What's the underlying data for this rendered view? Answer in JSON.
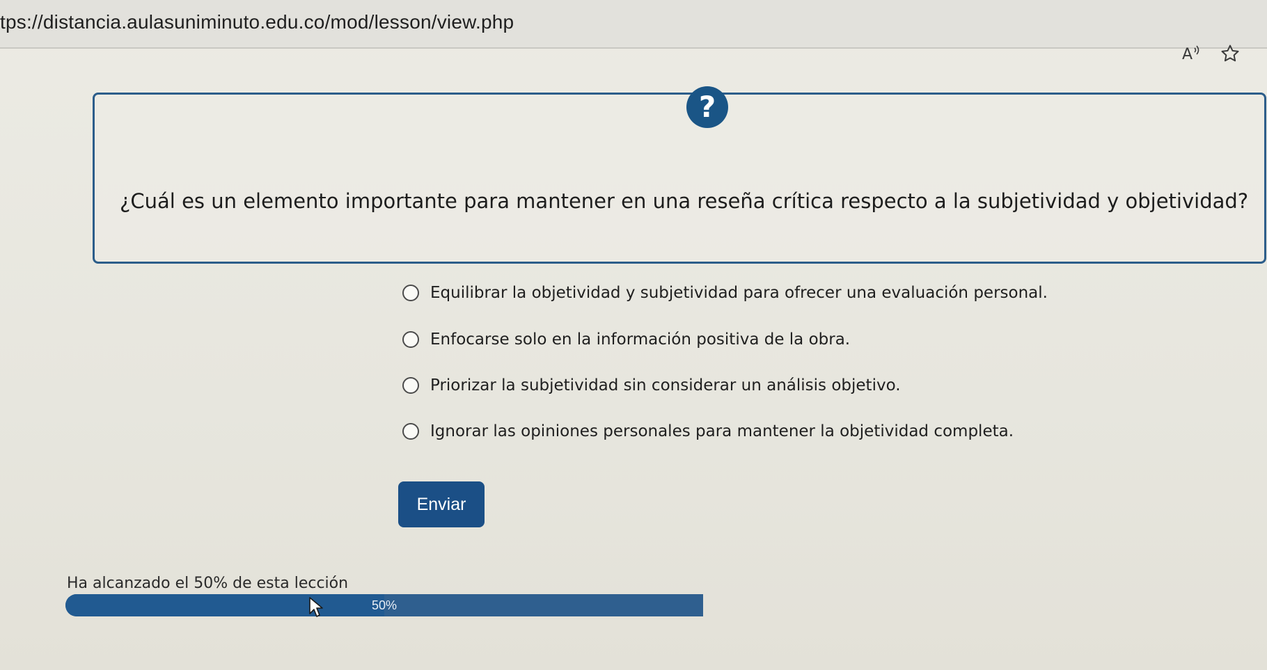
{
  "browser": {
    "url": "tps://distancia.aulasuniminuto.edu.co/mod/lesson/view.php",
    "read_aloud_icon": "read-aloud-icon",
    "favorite_icon": "star-icon"
  },
  "question": {
    "icon": "question-mark-icon",
    "icon_glyph": "?",
    "text": "¿Cuál es un elemento importante para mantener en una reseña crítica respecto a la subjetividad y objetividad?"
  },
  "options": [
    {
      "label": "Equilibrar la objetividad y subjetividad para ofrecer una evaluación personal.",
      "selected": false
    },
    {
      "label": "Enfocarse solo en la información positiva de la obra.",
      "selected": false
    },
    {
      "label": "Priorizar la subjetividad sin considerar un análisis objetivo.",
      "selected": false
    },
    {
      "label": "Ignorar las opiniones personales para mantener la objetividad completa.",
      "selected": false
    }
  ],
  "submit": {
    "label": "Enviar"
  },
  "progress": {
    "label": "Ha alcanzado el 50% de esta lección",
    "value_text": "50%",
    "value": 0.5
  },
  "colors": {
    "accent": "#1b4f86",
    "question_border": "#2c5d8a",
    "progress_bar": "#215a91"
  }
}
